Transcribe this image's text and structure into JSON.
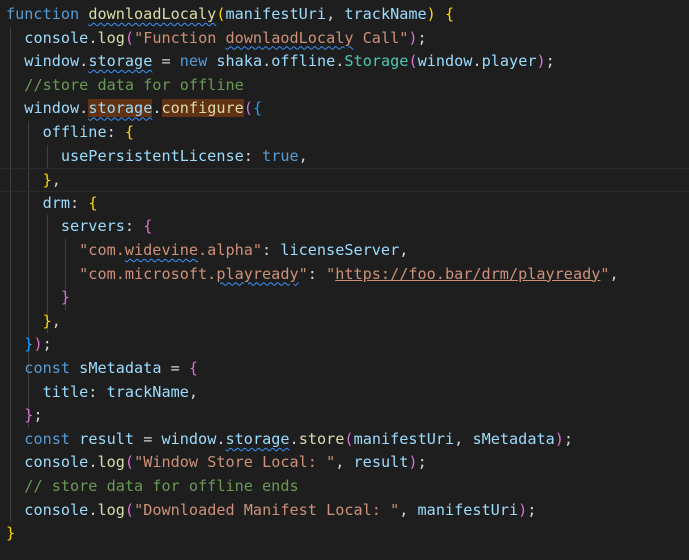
{
  "editor": {
    "theme_background": "#1e1e1e",
    "lines": [
      [
        [
          "kw",
          "function"
        ],
        [
          "op",
          " "
        ],
        [
          "fn",
          "downloadLocaly",
          "sq"
        ],
        [
          "b1",
          "("
        ],
        [
          "vr",
          "manifestUri"
        ],
        [
          "op",
          ", "
        ],
        [
          "vr",
          "trackName"
        ],
        [
          "b1",
          ")"
        ],
        [
          "op",
          " "
        ],
        [
          "b1",
          "{"
        ]
      ],
      [
        [
          "op",
          "  "
        ],
        [
          "vr",
          "console"
        ],
        [
          "op",
          "."
        ],
        [
          "fn",
          "log"
        ],
        [
          "b2",
          "("
        ],
        [
          "st",
          "\"Function "
        ],
        [
          "st",
          "downlaodLocaly",
          "sq"
        ],
        [
          "st",
          " Call\""
        ],
        [
          "b2",
          ")"
        ],
        [
          "op",
          ";"
        ]
      ],
      [
        [
          "op",
          "  "
        ],
        [
          "vr",
          "window"
        ],
        [
          "op",
          "."
        ],
        [
          "pr",
          "storage",
          "sq"
        ],
        [
          "op",
          " = "
        ],
        [
          "kw",
          "new"
        ],
        [
          "op",
          " "
        ],
        [
          "vr",
          "shaka"
        ],
        [
          "op",
          "."
        ],
        [
          "pr",
          "offline"
        ],
        [
          "op",
          "."
        ],
        [
          "cl",
          "Storage"
        ],
        [
          "b2",
          "("
        ],
        [
          "vr",
          "window"
        ],
        [
          "op",
          "."
        ],
        [
          "pr",
          "player"
        ],
        [
          "b2",
          ")"
        ],
        [
          "op",
          ";"
        ]
      ],
      [
        [
          "op",
          "  "
        ],
        [
          "cm",
          "//store data for offline"
        ]
      ],
      [
        [
          "op",
          "  "
        ],
        [
          "vr",
          "window"
        ],
        [
          "op",
          "."
        ],
        [
          "pr",
          "storage",
          "sq hl"
        ],
        [
          "op",
          "."
        ],
        [
          "fn",
          "configure",
          "hl"
        ],
        [
          "b2",
          "("
        ],
        [
          "b3",
          "{"
        ]
      ],
      [
        [
          "op",
          "    "
        ],
        [
          "pr",
          "offline"
        ],
        [
          "op",
          ": "
        ],
        [
          "b1",
          "{"
        ]
      ],
      [
        [
          "op",
          "      "
        ],
        [
          "pr",
          "usePersistentLicense"
        ],
        [
          "op",
          ": "
        ],
        [
          "kw",
          "true"
        ],
        [
          "op",
          ","
        ]
      ],
      [
        [
          "op",
          "    "
        ],
        [
          "b1",
          "}"
        ],
        [
          "op",
          ","
        ]
      ],
      [
        [
          "op",
          "    "
        ],
        [
          "pr",
          "drm"
        ],
        [
          "op",
          ": "
        ],
        [
          "b1",
          "{"
        ]
      ],
      [
        [
          "op",
          "      "
        ],
        [
          "pr",
          "servers"
        ],
        [
          "op",
          ": "
        ],
        [
          "b2",
          "{"
        ]
      ],
      [
        [
          "op",
          "        "
        ],
        [
          "st",
          "\"com."
        ],
        [
          "st",
          "widevine",
          "sq"
        ],
        [
          "st",
          ".alpha\""
        ],
        [
          "op",
          ": "
        ],
        [
          "vr",
          "licenseServer"
        ],
        [
          "op",
          ","
        ]
      ],
      [
        [
          "op",
          "        "
        ],
        [
          "st",
          "\"com.microsoft."
        ],
        [
          "st",
          "playready",
          "sq"
        ],
        [
          "st",
          "\""
        ],
        [
          "op",
          ": "
        ],
        [
          "st",
          "\""
        ],
        [
          "st",
          "https://foo.bar/drm/playready",
          "ul"
        ],
        [
          "st",
          "\""
        ],
        [
          "op",
          ","
        ]
      ],
      [
        [
          "op",
          "      "
        ],
        [
          "b2",
          "}"
        ]
      ],
      [
        [
          "op",
          "    "
        ],
        [
          "b1",
          "}"
        ],
        [
          "op",
          ","
        ]
      ],
      [
        [
          "op",
          "  "
        ],
        [
          "b3",
          "}"
        ],
        [
          "b2",
          ")"
        ],
        [
          "op",
          ";"
        ]
      ],
      [
        [
          "op",
          "  "
        ],
        [
          "kw",
          "const"
        ],
        [
          "op",
          " "
        ],
        [
          "vr",
          "sMetadata"
        ],
        [
          "op",
          " = "
        ],
        [
          "b2",
          "{"
        ]
      ],
      [
        [
          "op",
          "    "
        ],
        [
          "pr",
          "title"
        ],
        [
          "op",
          ": "
        ],
        [
          "vr",
          "trackName"
        ],
        [
          "op",
          ","
        ]
      ],
      [
        [
          "op",
          "  "
        ],
        [
          "b2",
          "}"
        ],
        [
          "op",
          ";"
        ]
      ],
      [
        [
          "op",
          "  "
        ],
        [
          "kw",
          "const"
        ],
        [
          "op",
          " "
        ],
        [
          "vr",
          "result"
        ],
        [
          "op",
          " = "
        ],
        [
          "vr",
          "window"
        ],
        [
          "op",
          "."
        ],
        [
          "pr",
          "storage",
          "sq"
        ],
        [
          "op",
          "."
        ],
        [
          "fn",
          "store"
        ],
        [
          "b2",
          "("
        ],
        [
          "vr",
          "manifestUri"
        ],
        [
          "op",
          ", "
        ],
        [
          "vr",
          "sMetadata"
        ],
        [
          "b2",
          ")"
        ],
        [
          "op",
          ";"
        ]
      ],
      [
        [
          "op",
          "  "
        ],
        [
          "vr",
          "console"
        ],
        [
          "op",
          "."
        ],
        [
          "fn",
          "log"
        ],
        [
          "b2",
          "("
        ],
        [
          "st",
          "\"Window Store Local: \""
        ],
        [
          "op",
          ", "
        ],
        [
          "vr",
          "result"
        ],
        [
          "b2",
          ")"
        ],
        [
          "op",
          ";"
        ]
      ],
      [
        [
          "op",
          "  "
        ],
        [
          "cm",
          "// store data for offline ends"
        ]
      ],
      [
        [
          "op",
          "  "
        ],
        [
          "vr",
          "console"
        ],
        [
          "op",
          "."
        ],
        [
          "fn",
          "log"
        ],
        [
          "b2",
          "("
        ],
        [
          "st",
          "\"Downloaded Manifest Local: \""
        ],
        [
          "op",
          ", "
        ],
        [
          "vr",
          "manifestUri"
        ],
        [
          "b2",
          ")"
        ],
        [
          "op",
          ";"
        ]
      ],
      [
        [
          "b1",
          "}"
        ]
      ]
    ]
  }
}
